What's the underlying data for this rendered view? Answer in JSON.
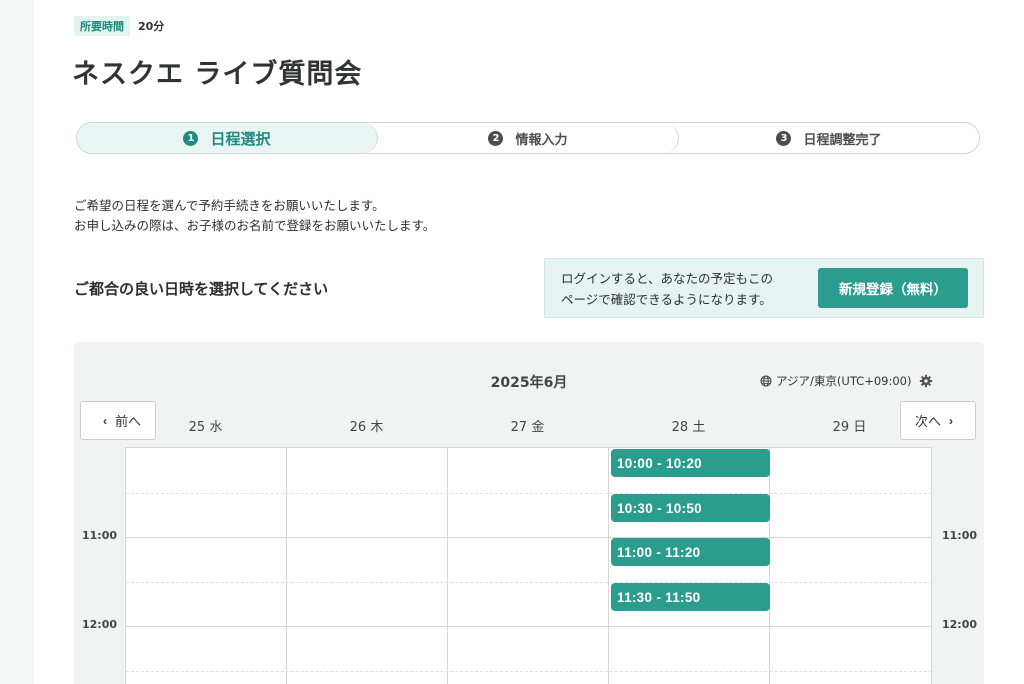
{
  "header": {
    "duration_label": "所要時間",
    "duration_value": "20分",
    "title": "ネスクエ ライブ質問会"
  },
  "steps": [
    {
      "num": "1",
      "label": "日程選択",
      "active": true
    },
    {
      "num": "2",
      "label": "情報入力",
      "active": false
    },
    {
      "num": "3",
      "label": "日程調整完了",
      "active": false
    }
  ],
  "intro": {
    "line1": "ご希望の日程を選んで予約手続きをお願いいたします。",
    "line2": "お申し込みの際は、お子様のお名前で登録をお願いいたします。"
  },
  "select_heading": "ご都合の良い日時を選択してください",
  "login": {
    "line1": "ログインすると、あなたの予定もこの",
    "line2": "ページで確認できるようになります。",
    "register_label": "新規登録（無料）"
  },
  "calendar": {
    "month": "2025年6月",
    "timezone": "アジア/東京(UTC+09:00)",
    "prev_label": "前へ",
    "next_label": "次へ",
    "days": [
      "25 水",
      "26 木",
      "27 金",
      "28 土",
      "29 日"
    ],
    "time_labels": [
      "11:00",
      "12:00"
    ],
    "slots": [
      "10:00 - 10:20",
      "10:30 - 10:50",
      "11:00 - 11:20",
      "11:30 - 11:50"
    ]
  },
  "colors": {
    "accent": "#2a9d8f",
    "accent_light": "#e6f3f2"
  }
}
